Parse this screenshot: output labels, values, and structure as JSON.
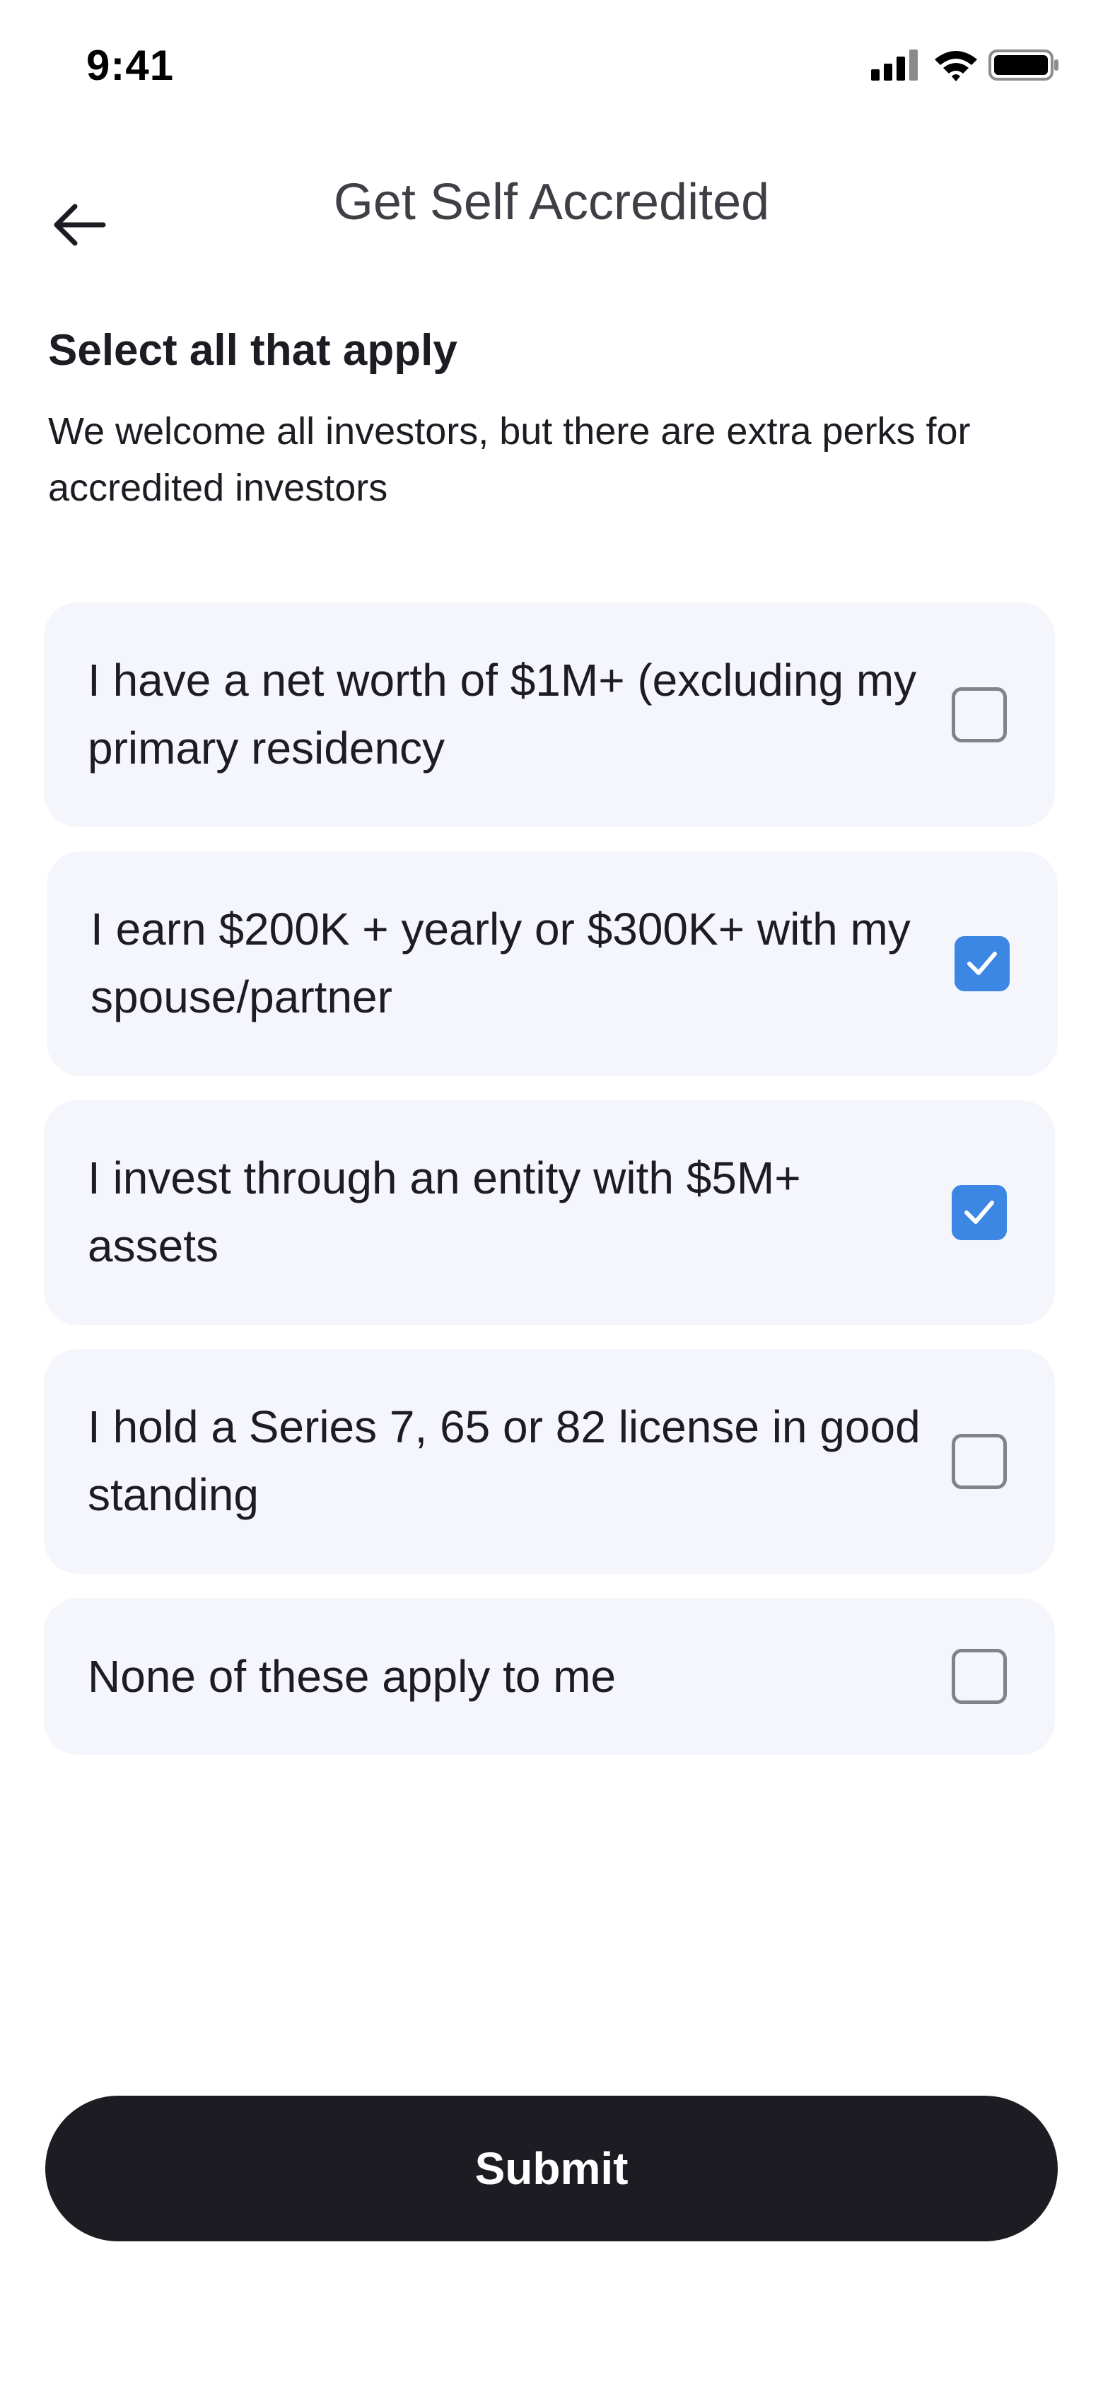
{
  "status_bar": {
    "time": "9:41",
    "icons": [
      "signal-icon",
      "wifi-icon",
      "battery-icon"
    ]
  },
  "header": {
    "back_icon": "arrow-left-icon",
    "title": "Get Self Accredited"
  },
  "intro": {
    "heading": "Select all that apply",
    "description": "We welcome all investors, but there are extra perks for accredited investors"
  },
  "options": [
    {
      "label": "I have a net worth of $1M+ (excluding my primary residency",
      "checked": false
    },
    {
      "label": "I earn $200K + yearly or $300K+ with my spouse/partner",
      "checked": true
    },
    {
      "label": "I invest through an entity with $5M+ assets",
      "checked": true
    },
    {
      "label": "I hold a Series 7, 65 or 82 license in good standing",
      "checked": false
    },
    {
      "label": "None of these apply to me",
      "checked": false
    }
  ],
  "submit": {
    "label": "Submit"
  },
  "colors": {
    "accent": "#3b87e3",
    "card_background": "#f5f6fb",
    "primary_button": "#1c1c22"
  }
}
